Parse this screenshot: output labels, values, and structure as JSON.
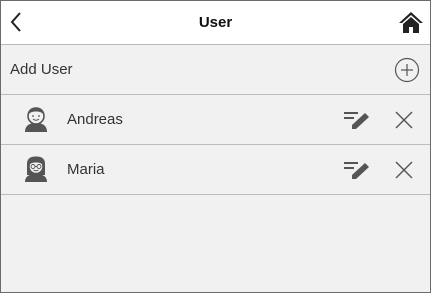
{
  "header": {
    "title": "User",
    "back_icon": "chevron-left-icon",
    "home_icon": "home-icon"
  },
  "add_user": {
    "label": "Add User",
    "icon": "plus-circle-icon"
  },
  "users": [
    {
      "name": "Andreas",
      "avatar": "male-avatar-icon",
      "edit_icon": "edit-icon",
      "delete_icon": "close-icon"
    },
    {
      "name": "Maria",
      "avatar": "female-avatar-icon",
      "edit_icon": "edit-icon",
      "delete_icon": "close-icon"
    }
  ],
  "colors": {
    "background": "#f1f1f1",
    "header_background": "#ffffff",
    "divider": "#bdbdbd",
    "icon_gray": "#555555",
    "text": "#333333"
  }
}
